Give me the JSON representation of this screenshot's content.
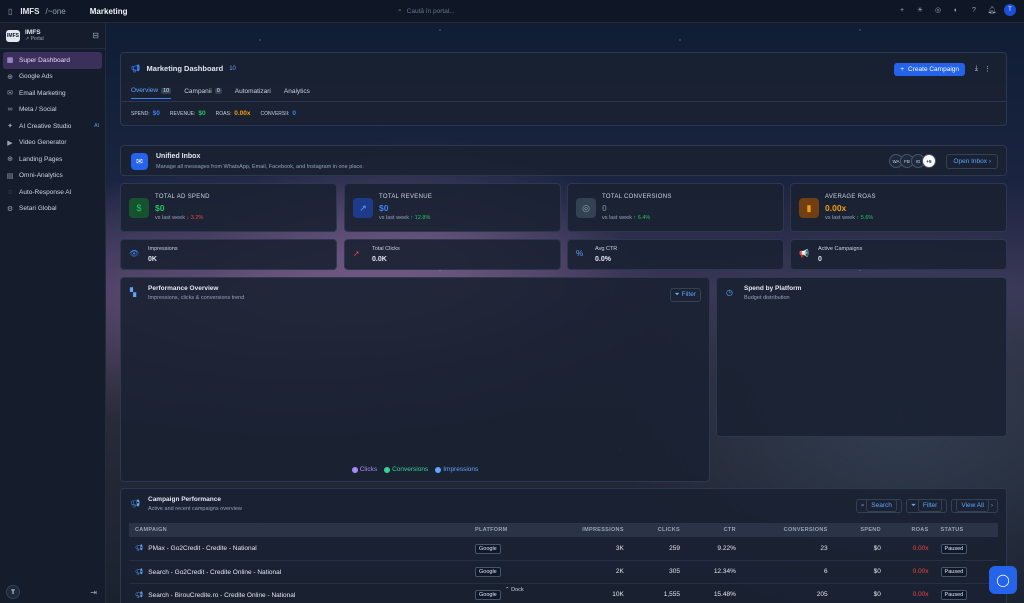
{
  "topbar": {
    "brand": "IMFS",
    "brand_suffix": "/~one",
    "breadcrumb": "Marketing",
    "search_placeholder": "Caută în portal...",
    "avatar": "T"
  },
  "workspace": {
    "name": "IMFS",
    "sub": "↗ Portal",
    "logo": "IMFS"
  },
  "sidebar": {
    "items": [
      {
        "label": "Super Dashboard",
        "icon": "grid-icon",
        "active": true
      },
      {
        "label": "Google Ads",
        "icon": "globe-icon"
      },
      {
        "label": "Email Marketing",
        "icon": "mail-icon"
      },
      {
        "label": "Meta / Social",
        "icon": "meta-icon"
      },
      {
        "label": "AI Creative Studio",
        "icon": "sparkle-icon",
        "badge": "AI"
      },
      {
        "label": "Video Generator",
        "icon": "video-icon"
      },
      {
        "label": "Landing Pages",
        "icon": "globe-icon"
      },
      {
        "label": "Omni-Analytics",
        "icon": "chart-icon"
      },
      {
        "label": "Auto-Response AI",
        "icon": "chat-icon"
      },
      {
        "label": "Setari Global",
        "icon": "gear-icon"
      }
    ],
    "user": "T"
  },
  "dashboard": {
    "title": "Marketing Dashboard",
    "count": "10",
    "create_label": "Create Campaign",
    "tabs": [
      {
        "label": "Overview",
        "count": "10"
      },
      {
        "label": "Campanii",
        "count": "0"
      },
      {
        "label": "Automatizari",
        "count": ""
      },
      {
        "label": "Analytics",
        "count": ""
      }
    ],
    "stats": [
      {
        "label": "SPEND:",
        "value": "$0",
        "color": "#3b82f6"
      },
      {
        "label": "REVENUE:",
        "value": "$0",
        "color": "#22c55e"
      },
      {
        "label": "ROAS:",
        "value": "0.00x",
        "color": "#f59e0b"
      },
      {
        "label": "CONVERSII:",
        "value": "0",
        "color": "#3b82f6"
      }
    ]
  },
  "inbox": {
    "title": "Unified Inbox",
    "subtitle": "Manage all messages from WhatsApp, Email, Facebook, and Instagram in one place.",
    "channels": [
      "WA",
      "FB",
      "IG"
    ],
    "more": "+5",
    "button": "Open Inbox"
  },
  "kpis": [
    {
      "label": "TOTAL AD SPEND",
      "value": "$0",
      "color": "#22c55e",
      "trend_label": "vs last week",
      "trend": "↓ 3.2%",
      "dir": "down",
      "icon": "$",
      "icon_bg": "#14532d",
      "icon_color": "#22c55e"
    },
    {
      "label": "TOTAL REVENUE",
      "value": "$0",
      "color": "#3b82f6",
      "trend_label": "vs last week",
      "trend": "↑ 12.8%",
      "dir": "up",
      "icon": "↗",
      "icon_bg": "#1e3a8a",
      "icon_color": "#60a5fa"
    },
    {
      "label": "TOTAL CONVERSIONS",
      "value": "0",
      "color": "#64748b",
      "trend_label": "vs last week",
      "trend": "↑ 6.4%",
      "dir": "up",
      "icon": "◎",
      "icon_bg": "#334155",
      "icon_color": "#94a3b8"
    },
    {
      "label": "AVERAGE ROAS",
      "value": "0.00x",
      "color": "#f59e0b",
      "trend_label": "vs last week",
      "trend": "↑ 5.6%",
      "dir": "up",
      "icon": "▮",
      "icon_bg": "#713f12",
      "icon_color": "#f59e0b"
    }
  ],
  "mini_kpis": [
    {
      "label": "Impressions",
      "value": "0K",
      "icon": "👁",
      "color": "#3b82f6"
    },
    {
      "label": "Total Clicks",
      "value": "0.0K",
      "icon": "➚",
      "color": "#ef4444"
    },
    {
      "label": "Avg CTR",
      "value": "0.0%",
      "icon": "%",
      "color": "#60a5fa"
    },
    {
      "label": "Active Campaigns",
      "value": "0",
      "icon": "📢",
      "color": "#f59e0b"
    }
  ],
  "performance": {
    "title": "Performance Overview",
    "subtitle": "Impressions, clicks & conversions trend",
    "filter": "Filter",
    "legend": [
      {
        "name": "Clicks",
        "color": "#a78bfa"
      },
      {
        "name": "Conversions",
        "color": "#34d399"
      },
      {
        "name": "Impressions",
        "color": "#60a5fa"
      }
    ]
  },
  "spend_platform": {
    "title": "Spend by Platform",
    "subtitle": "Budget distribution"
  },
  "campaigns": {
    "title": "Campaign Performance",
    "subtitle": "Active and recent campaigns overview",
    "buttons": [
      "Search",
      "Filter",
      "View All"
    ],
    "headers": [
      "CAMPAIGN",
      "PLATFORM",
      "IMPRESSIONS",
      "CLICKS",
      "CTR",
      "CONVERSIONS",
      "SPEND",
      "ROAS",
      "STATUS"
    ],
    "rows": [
      [
        "PMax - Go2Credit - Credite - National",
        "Google",
        "3K",
        "259",
        "9.22%",
        "23",
        "$0",
        "0.00x",
        "Paused"
      ],
      [
        "Search - Go2Credit - Credite Online - National",
        "Google",
        "2K",
        "305",
        "12.34%",
        "6",
        "$0",
        "0.00x",
        "Paused"
      ],
      [
        "Search - BirouCredite.ro - Credite Online - National",
        "Google",
        "10K",
        "1,555",
        "15.48%",
        "205",
        "$0",
        "0.00x",
        "Paused"
      ]
    ]
  },
  "dock": "Dock",
  "colors": {
    "accent": "#2563eb",
    "sidebar_active": "#3b2f5c"
  }
}
